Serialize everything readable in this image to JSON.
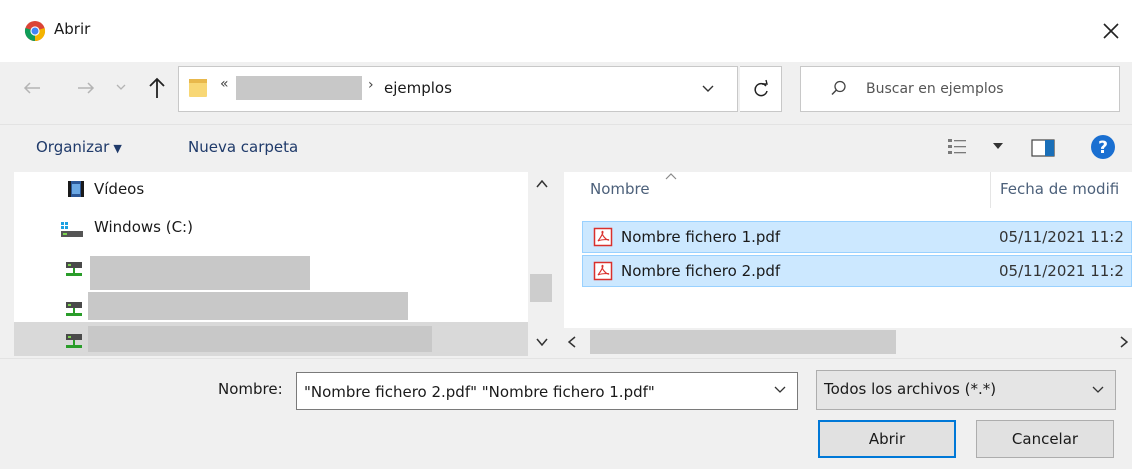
{
  "window": {
    "title": "Abrir",
    "app_icon": "chrome-icon",
    "close_icon": "close-icon"
  },
  "nav": {
    "back_icon": "arrow-left-icon",
    "forward_icon": "arrow-right-icon",
    "recent_icon": "chevron-down-icon",
    "up_icon": "arrow-up-icon"
  },
  "address": {
    "folder_icon": "folder-icon",
    "overflow": "«",
    "separator": "›",
    "current": "ejemplos",
    "dropdown_icon": "chevron-down-icon",
    "refresh_icon": "refresh-icon"
  },
  "search": {
    "placeholder": "Buscar en ejemplos",
    "icon": "search-icon"
  },
  "toolbar": {
    "organize_label": "Organizar",
    "organize_caret": "▼",
    "new_folder_label": "Nueva carpeta",
    "view_icon": "view-details-icon",
    "preview_icon": "preview-pane-icon",
    "help_icon": "help-icon"
  },
  "tree": [
    {
      "label": "Vídeos",
      "icon": "videos-icon"
    },
    {
      "label": "Windows (C:)",
      "icon": "drive-icon"
    },
    {
      "label": "",
      "icon": "network-drive-icon",
      "redacted": true
    },
    {
      "label": "",
      "icon": "network-drive-icon",
      "redacted": true
    },
    {
      "label": "",
      "icon": "network-drive-icon",
      "redacted": true,
      "selected": true
    }
  ],
  "columns": {
    "name": "Nombre",
    "date": "Fecha de modifi"
  },
  "files": [
    {
      "name": "Nombre fichero 1.pdf",
      "date": "05/11/2021 11:2",
      "icon": "pdf-icon",
      "selected": true
    },
    {
      "name": "Nombre fichero 2.pdf",
      "date": "05/11/2021 11:2",
      "icon": "pdf-icon",
      "selected": true
    }
  ],
  "footer": {
    "filename_label": "Nombre:",
    "filename_value": "\"Nombre fichero 2.pdf\" \"Nombre fichero 1.pdf\"",
    "filetype_value": "Todos los archivos (*.*)",
    "open_label": "Abrir",
    "cancel_label": "Cancelar"
  },
  "colors": {
    "selection_bg": "#cce8ff",
    "selection_border": "#99d1ff",
    "default_button_border": "#0078d7",
    "link_blue": "#1f3a6a"
  }
}
